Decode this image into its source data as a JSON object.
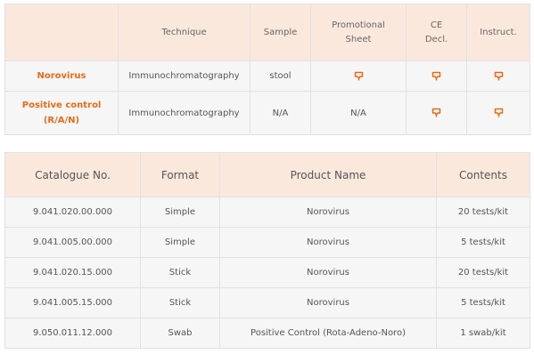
{
  "table1": {
    "headers": [
      "",
      "Technique",
      "Sample",
      "Promotional Sheet",
      "CE Decl.",
      "Instruct."
    ],
    "rows": [
      {
        "product": "Norovirus",
        "technique": "Immunochromatography",
        "sample": "stool",
        "promo": "download-icon",
        "ce": "download-icon",
        "instruct": "download-icon"
      },
      {
        "product": "Positive control (R/A/N)",
        "technique": "Immunochromatography",
        "sample": "N/A",
        "promo": "N/A",
        "ce": "download-icon",
        "instruct": "download-icon"
      }
    ]
  },
  "table2": {
    "headers": [
      "Catalogue No.",
      "Format",
      "Product Name",
      "Contents"
    ],
    "rows": [
      [
        "9.041.020.00.000",
        "Simple",
        "Norovirus",
        "20 tests/kit"
      ],
      [
        "9.041.005.00.000",
        "Simple",
        "Norovirus",
        "5 tests/kit"
      ],
      [
        "9.041.020.15.000",
        "Stick",
        "Norovirus",
        "20 tests/kit"
      ],
      [
        "9.041.005.15.000",
        "Stick",
        "Norovirus",
        "5 tests/kit"
      ],
      [
        "9.050.011.12.000",
        "Swab",
        "Positive Control (Rota-Adeno-Noro)",
        "1 swab/kit"
      ]
    ]
  },
  "colors": {
    "accent": "#e86a14",
    "header_bg": "#fbe8dd",
    "row_bg": "#f6f6f6",
    "border": "#e1e1e1"
  }
}
